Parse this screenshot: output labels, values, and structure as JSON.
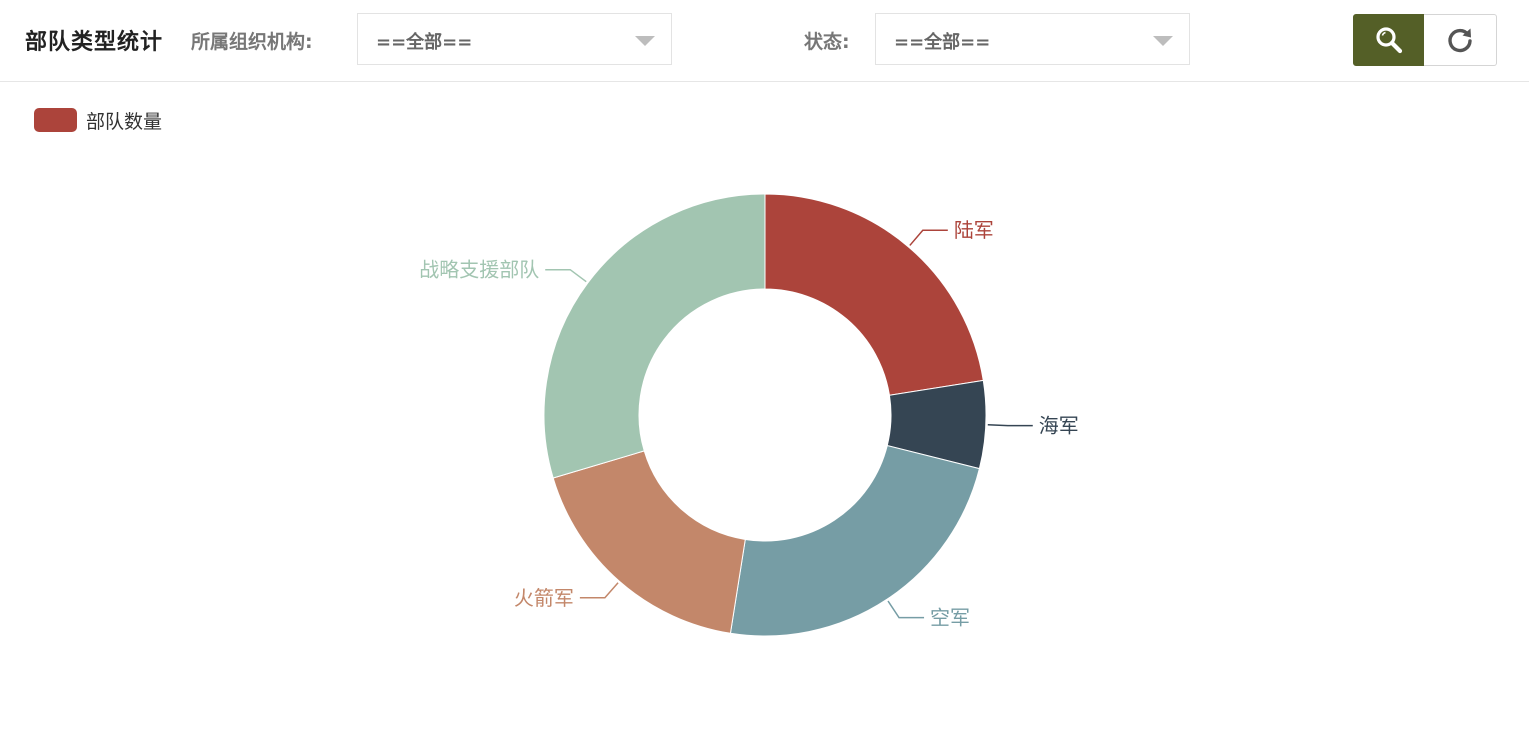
{
  "header": {
    "title": "部队类型统计",
    "org_label": "所属组织机构:",
    "org_select_value": "==全部==",
    "status_label": "状态:",
    "status_select_value": "==全部==",
    "search_icon": "search-icon",
    "reset_icon": "refresh-icon"
  },
  "colors": {
    "accent": "#545f27"
  },
  "chart_data": {
    "type": "pie",
    "variant": "donut",
    "title": "",
    "legend": [
      "部队数量"
    ],
    "legend_color": "#ac443b",
    "legend_position": "top-left",
    "series": [
      {
        "name": "部队数量",
        "slices": [
          {
            "label": "陆军",
            "value": 22.5,
            "color": "#ac443b"
          },
          {
            "label": "海军",
            "value": 6.4,
            "color": "#354553"
          },
          {
            "label": "空军",
            "value": 23.6,
            "color": "#769da5"
          },
          {
            "label": "火箭军",
            "value": 17.9,
            "color": "#c3876a"
          },
          {
            "label": "战略支援部队",
            "value": 29.6,
            "color": "#a2c5b1"
          }
        ]
      }
    ]
  }
}
